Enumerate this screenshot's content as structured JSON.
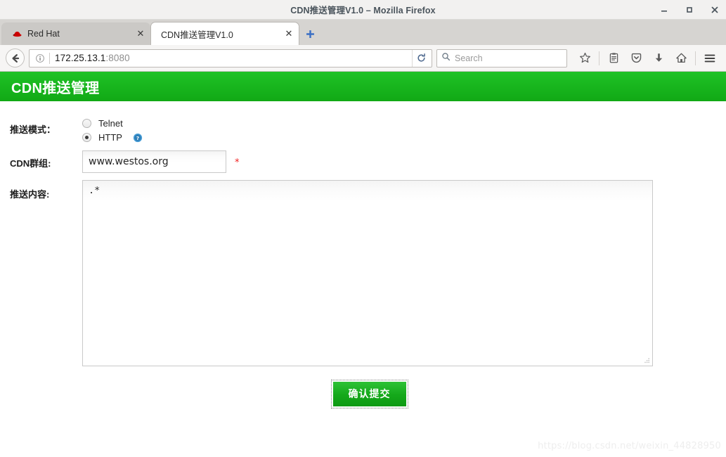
{
  "window": {
    "title": "CDN推送管理V1.0 – Mozilla Firefox",
    "minimize_label": "–",
    "maximize_label": "□",
    "close_label": "✕"
  },
  "tabs": [
    {
      "label": "Red Hat",
      "favicon": "redhat-logo-icon",
      "close_label": "✕",
      "active": false
    },
    {
      "label": "CDN推送管理V1.0",
      "favicon": "none",
      "close_label": "✕",
      "active": true
    }
  ],
  "newtab": {
    "label": "+",
    "icon": "plus-icon"
  },
  "navbar": {
    "back_icon": "back-arrow-icon",
    "identity_icon": "info-icon",
    "url_host": "172.25.13.1",
    "url_port": ":8080",
    "reload_icon": "reload-icon",
    "search": {
      "placeholder": "Search",
      "icon": "search-icon"
    },
    "icons": [
      {
        "name": "bookmark-star-icon"
      },
      {
        "name": "library-icon"
      },
      {
        "name": "pocket-icon"
      },
      {
        "name": "downloads-icon"
      },
      {
        "name": "home-icon"
      },
      {
        "name": "hamburger-menu-icon"
      }
    ]
  },
  "app": {
    "header_title": "CDN推送管理",
    "header_color": "#13ac17",
    "accent_color": "#19bb22",
    "required_color": "#f02020"
  },
  "form": {
    "mode": {
      "label": "推送模式：",
      "options": [
        {
          "label": "Telnet",
          "checked": false
        },
        {
          "label": "HTTP",
          "checked": true,
          "help_icon": "question-help-icon"
        }
      ]
    },
    "group": {
      "label": "CDN群组:",
      "value": "www.westos.org",
      "placeholder": "",
      "required_marker": "*"
    },
    "content": {
      "label": "推送内容:",
      "value": ".*",
      "placeholder": ""
    },
    "submit": {
      "label": "确认提交"
    }
  },
  "watermark": {
    "text": "https://blog.csdn.net/weixin_44828950"
  }
}
